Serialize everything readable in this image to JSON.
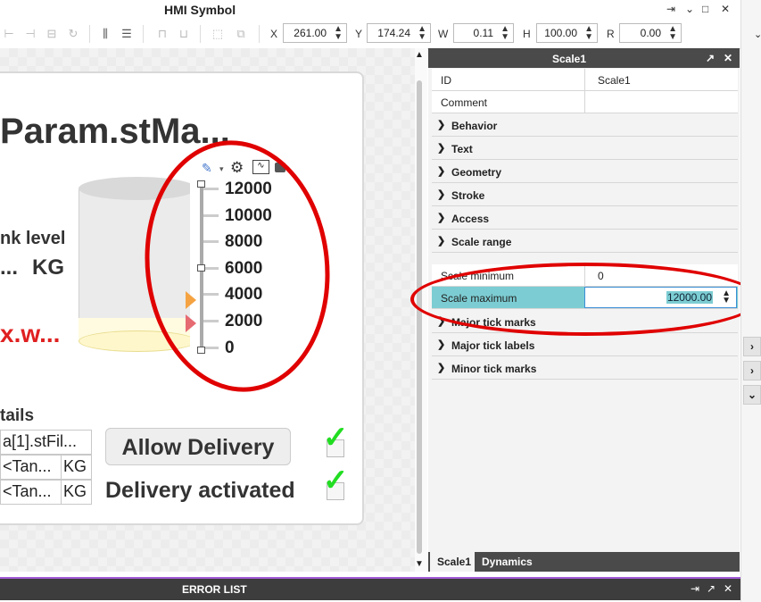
{
  "window": {
    "title": "HMI Symbol",
    "controls": [
      "⇥",
      "⌄",
      "□",
      "✕"
    ]
  },
  "toolbar": {
    "x_label": "X",
    "x_value": "261.00",
    "y_label": "Y",
    "y_value": "174.24",
    "w_label": "W",
    "w_value": "0.11",
    "h_label": "H",
    "h_value": "100.00",
    "r_label": "R",
    "r_value": "0.00"
  },
  "canvas": {
    "title_text": "Param.stMa...",
    "tank_level_label": "nk level",
    "tank_value": "...",
    "tank_unit": "KG",
    "red_text": "x.w...",
    "scale_labels": [
      "12000",
      "10000",
      "8000",
      "6000",
      "4000",
      "2000",
      "0"
    ],
    "details_label": "tails",
    "table_rows": [
      [
        "a[1].stFil..."
      ],
      [
        "<Tan...",
        "KG"
      ],
      [
        "<Tan...",
        "KG"
      ]
    ],
    "allow_button": "Allow Delivery",
    "delivery_activated": "Delivery activated"
  },
  "props": {
    "header": "Scale1",
    "id_key": "ID",
    "id_value": "Scale1",
    "comment_key": "Comment",
    "comment_value": "",
    "groups": [
      "Behavior",
      "Text",
      "Geometry",
      "Stroke",
      "Access",
      "Scale range"
    ],
    "scale_min_key": "Scale minimum",
    "scale_min_value": "0",
    "scale_max_key": "Scale maximum",
    "scale_max_value": "12000.00",
    "groups2": [
      "Major tick marks",
      "Major tick labels",
      "Minor tick marks"
    ],
    "tabs": [
      "Scale1",
      "Dynamics"
    ]
  },
  "error_list": {
    "title": "ERROR LIST"
  },
  "colors": {
    "accent": "#7ccdd3",
    "annotation": "#e00000",
    "check": "#22dd22"
  }
}
